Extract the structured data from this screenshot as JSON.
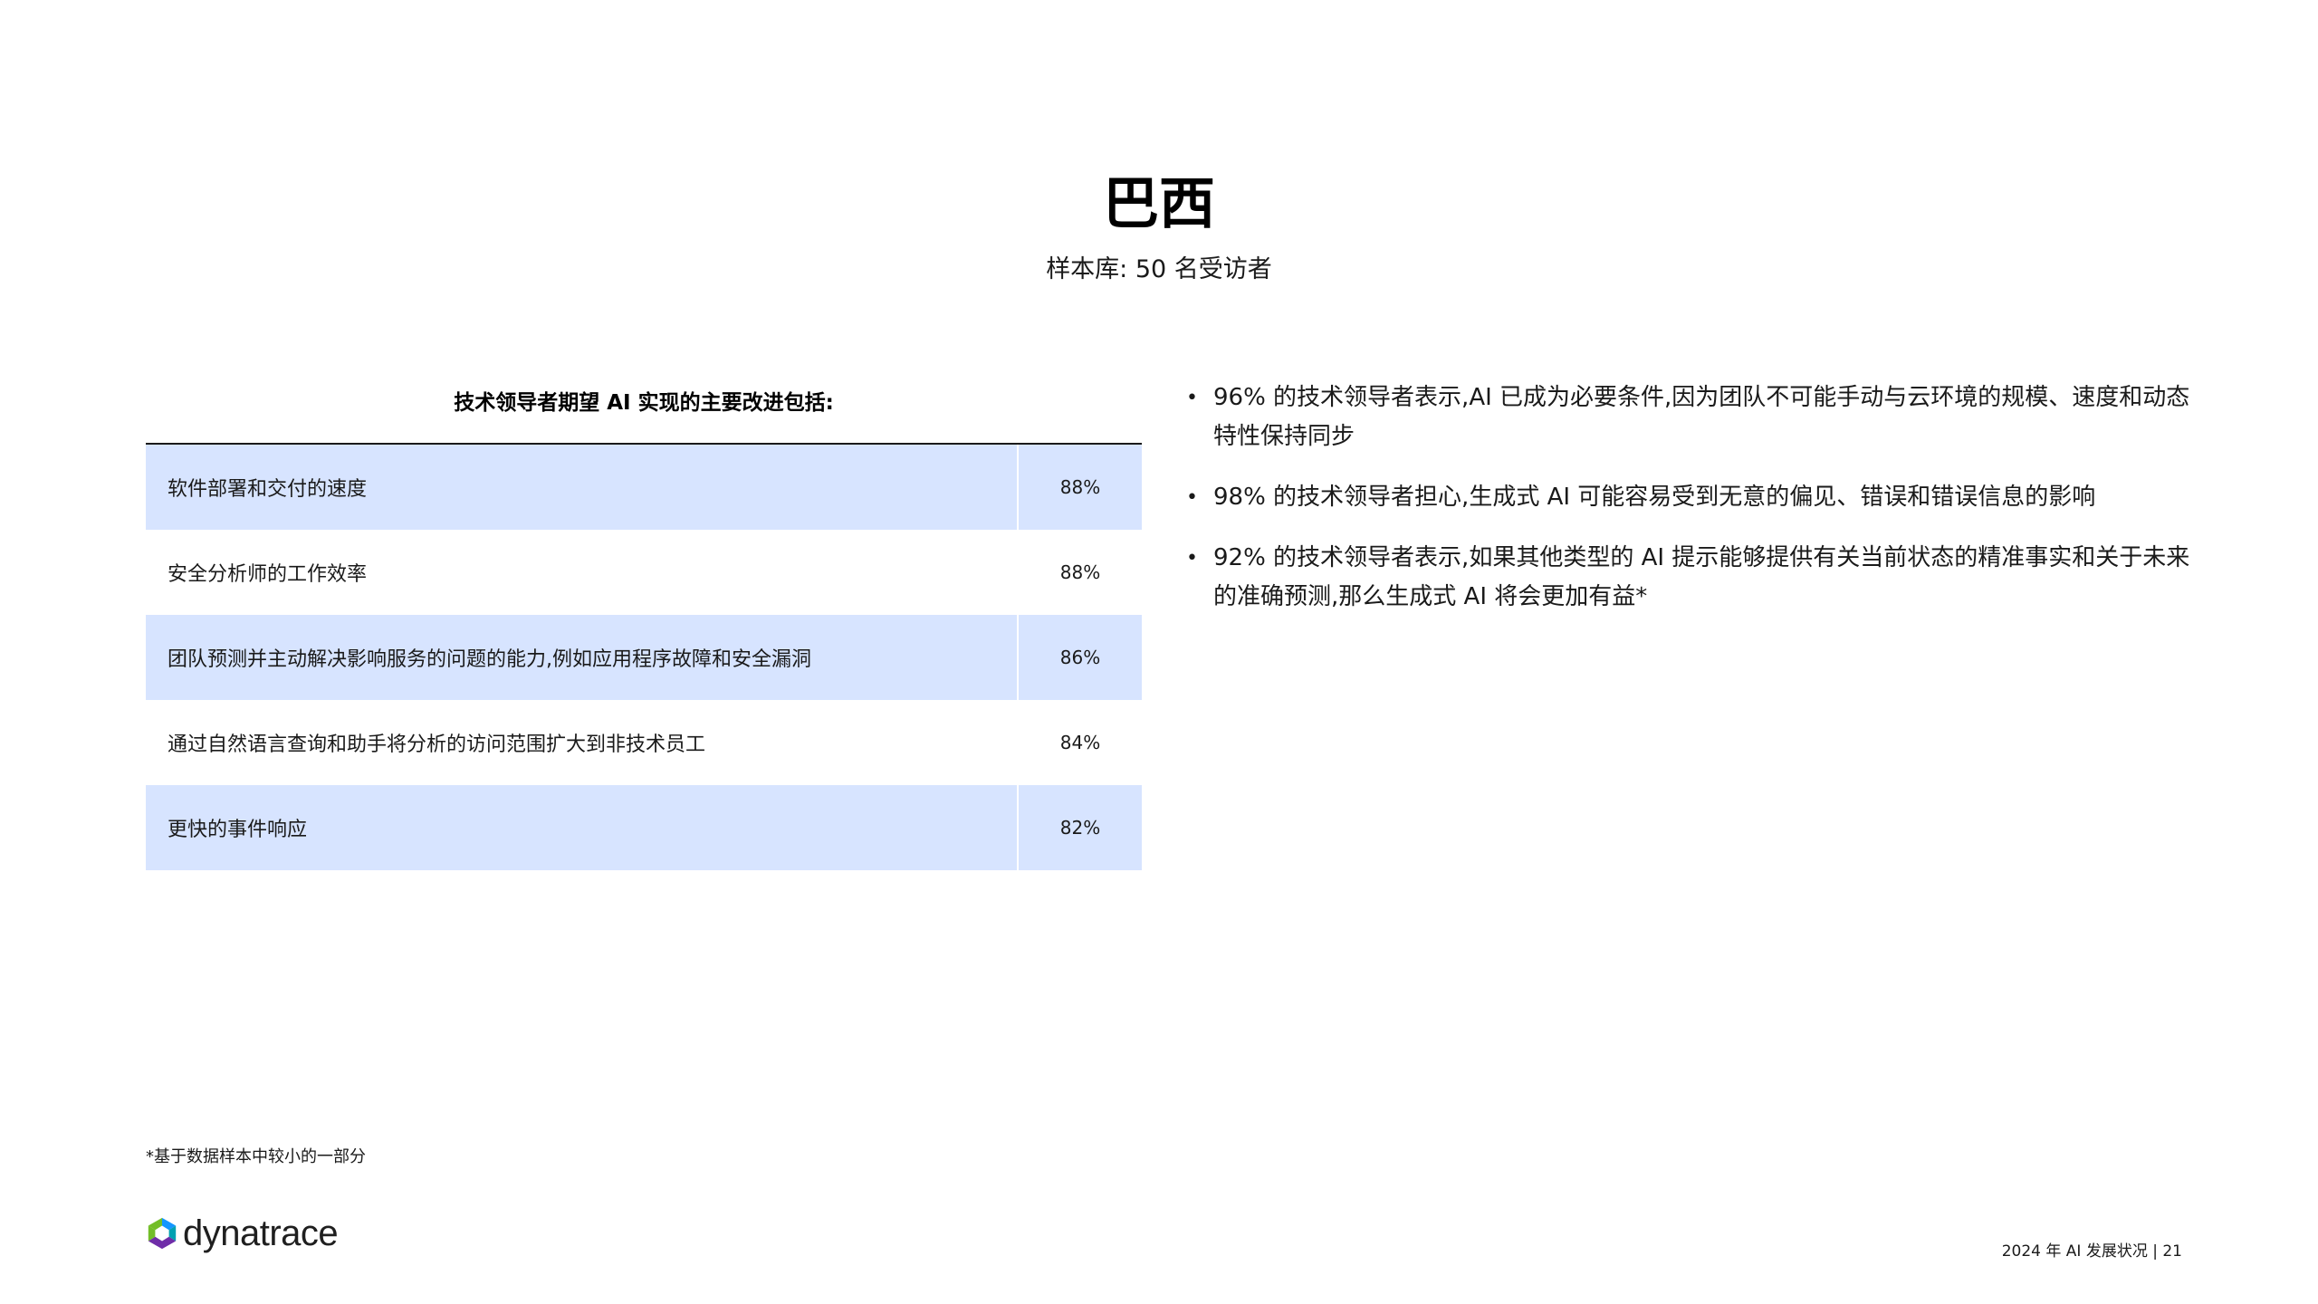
{
  "title": "巴西",
  "subtitle": "样本库: 50 名受访者",
  "table": {
    "heading": "技术领导者期望 AI 实现的主要改进包括:",
    "rows": [
      {
        "label": "软件部署和交付的速度",
        "value": "88%"
      },
      {
        "label": "安全分析师的工作效率",
        "value": "88%"
      },
      {
        "label": "团队预测并主动解决影响服务的问题的能力,例如应用程序故障和安全漏洞",
        "value": "86%"
      },
      {
        "label": "通过自然语言查询和助手将分析的访问范围扩大到非技术员工",
        "value": "84%"
      },
      {
        "label": "更快的事件响应",
        "value": "82%"
      }
    ]
  },
  "bullets": [
    "96% 的技术领导者表示,AI 已成为必要条件,因为团队不可能手动与云环境的规模、速度和动态特性保持同步",
    "98% 的技术领导者担心,生成式 AI 可能容易受到无意的偏见、错误和错误信息的影响",
    "92% 的技术领导者表示,如果其他类型的 AI 提示能够提供有关当前状态的精准事实和关于未来的准确预测,那么生成式 AI 将会更加有益*"
  ],
  "footnote": "*基于数据样本中较小的一部分",
  "logo_text": "dynatrace",
  "footer": "2024 年 AI 发展状况 | 21",
  "colors": {
    "row_shade": "#d7e4ff",
    "logo_green": "#73be28",
    "logo_blue": "#1496ff",
    "logo_purple": "#6f2da8",
    "logo_teal": "#00a1b2"
  }
}
